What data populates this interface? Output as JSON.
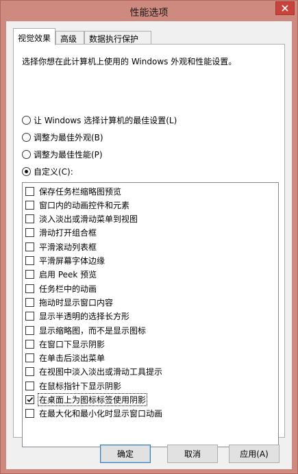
{
  "window": {
    "title": "性能选项"
  },
  "tabs": [
    {
      "label": "视觉效果",
      "active": true
    },
    {
      "label": "高级",
      "active": false
    },
    {
      "label": "数据执行保护",
      "active": false
    }
  ],
  "description": "选择你想在此计算机上使用的 Windows 外观和性能设置。",
  "radios": [
    {
      "label": "让 Windows 选择计算机的最佳设置(L)",
      "checked": false
    },
    {
      "label": "调整为最佳外观(B)",
      "checked": false
    },
    {
      "label": "调整为最佳性能(P)",
      "checked": false
    },
    {
      "label": "自定义(C):",
      "checked": true
    }
  ],
  "options": [
    {
      "label": "保存任务栏缩略图预览",
      "checked": false
    },
    {
      "label": "窗口内的动画控件和元素",
      "checked": false
    },
    {
      "label": "淡入淡出或滑动菜单到视图",
      "checked": false
    },
    {
      "label": "滑动打开组合框",
      "checked": false
    },
    {
      "label": "平滑滚动列表框",
      "checked": false
    },
    {
      "label": "平滑屏幕字体边缘",
      "checked": false
    },
    {
      "label": "启用 Peek 预览",
      "checked": false
    },
    {
      "label": "任务栏中的动画",
      "checked": false
    },
    {
      "label": "拖动时显示窗口内容",
      "checked": false
    },
    {
      "label": "显示半透明的选择长方形",
      "checked": false
    },
    {
      "label": "显示缩略图，而不是显示图标",
      "checked": false
    },
    {
      "label": "在窗口下显示阴影",
      "checked": false
    },
    {
      "label": "在单击后淡出菜单",
      "checked": false
    },
    {
      "label": "在视图中淡入淡出或滑动工具提示",
      "checked": false
    },
    {
      "label": "在鼠标指针下显示阴影",
      "checked": false
    },
    {
      "label": "在桌面上为图标标签使用阴影",
      "checked": true,
      "selected": true
    },
    {
      "label": "在最大化和最小化时显示窗口动画",
      "checked": false
    }
  ],
  "buttons": {
    "ok": "确定",
    "cancel": "取消",
    "apply": "应用(A)"
  },
  "colors": {
    "titlebar": "#cf8a7f",
    "close": "#c7433b",
    "default_border": "#3c7fb1"
  }
}
